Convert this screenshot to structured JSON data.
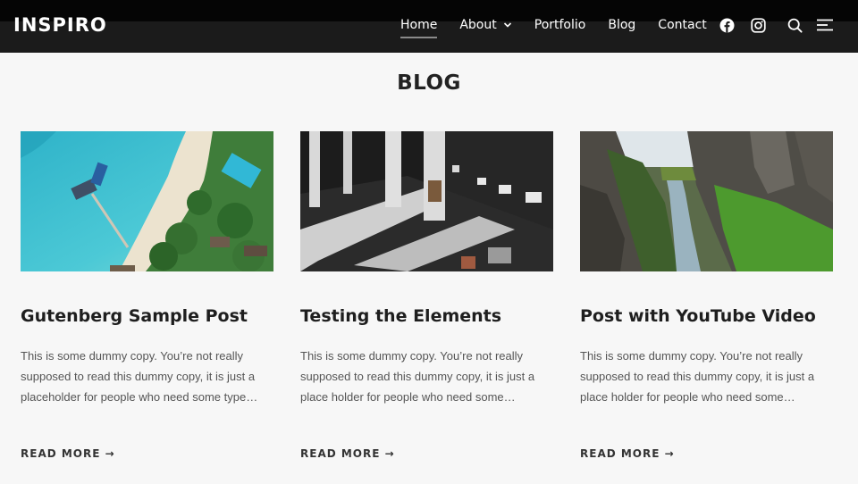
{
  "site": {
    "logo": "INSPIRO"
  },
  "nav": {
    "items": [
      {
        "label": "Home"
      },
      {
        "label": "About"
      },
      {
        "label": "Portfolio"
      },
      {
        "label": "Blog"
      },
      {
        "label": "Contact"
      }
    ],
    "icons": [
      "facebook-icon",
      "instagram-icon",
      "search-icon",
      "sidebar-menu-icon"
    ]
  },
  "page": {
    "title": "BLOG"
  },
  "posts": [
    {
      "title": "Gutenberg Sample Post",
      "excerpt": "This is some dummy copy. You’re not really supposed to read this dummy copy, it is just a placeholder for people who need some type…",
      "more": "READ MORE →"
    },
    {
      "title": "Testing the Elements",
      "excerpt": "This is some dummy copy. You’re not really supposed to read this dummy copy, it is just a place holder for people who need some…",
      "more": "READ MORE →"
    },
    {
      "title": "Post with YouTube Video",
      "excerpt": "This is some dummy copy. You’re not really supposed to read this dummy copy, it is just a place holder for people who need some…",
      "more": "READ MORE →"
    }
  ]
}
